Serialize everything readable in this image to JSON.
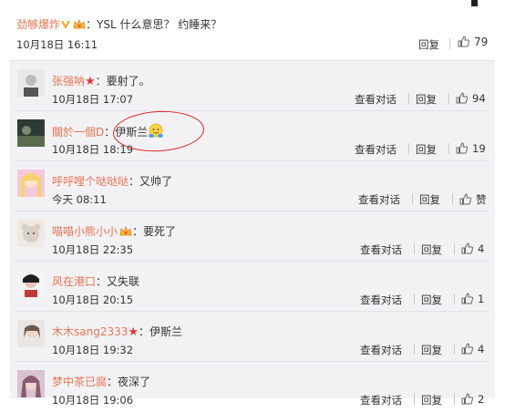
{
  "top_comment": {
    "username": "劲够爆炸",
    "text": "：YSL 什么意思？ 约睡来？",
    "time": "10月18日 16:11",
    "reply_label": "回复",
    "likes": "79",
    "badges": [
      "v-badge-icon",
      "crown-icon"
    ]
  },
  "action_labels": {
    "view_conversation": "查看对话",
    "reply": "回复"
  },
  "replies": [
    {
      "username": "张强呐",
      "badge": "star",
      "text": "：要射了。",
      "time": "10月18日 17:07",
      "view_conv": true,
      "likes": "94"
    },
    {
      "username": "關於一個D",
      "badge": "",
      "text": "：伊斯兰",
      "emoji": "hug-emoji",
      "time": "10月18日 18:19",
      "view_conv": true,
      "likes": "19"
    },
    {
      "username": "呼呼哩个哒哒哒",
      "badge": "",
      "text": "：又帅了",
      "time": "今天 08:11",
      "view_conv": true,
      "likes": "赞"
    },
    {
      "username": "喵喵小熊小小",
      "badge": "crown",
      "text": "：要死了",
      "time": "10月18日 22:35",
      "view_conv": true,
      "likes": "4"
    },
    {
      "username": "风在港口",
      "badge": "",
      "text": "：又失联",
      "time": "10月18日 20:15",
      "view_conv": true,
      "likes": "1"
    },
    {
      "username": "木木sang2333",
      "badge": "star",
      "text": "：伊斯兰",
      "time": "10月18日 19:32",
      "view_conv": true,
      "likes": "4"
    },
    {
      "username": "梦中茶已腐",
      "badge": "",
      "text": "：夜深了",
      "time": "10月18日 19:06",
      "view_conv": true,
      "likes": "2"
    }
  ],
  "colors": {
    "username": "#eb7350",
    "list_bg": "#f2f2f5",
    "annotation": "#e02020"
  }
}
